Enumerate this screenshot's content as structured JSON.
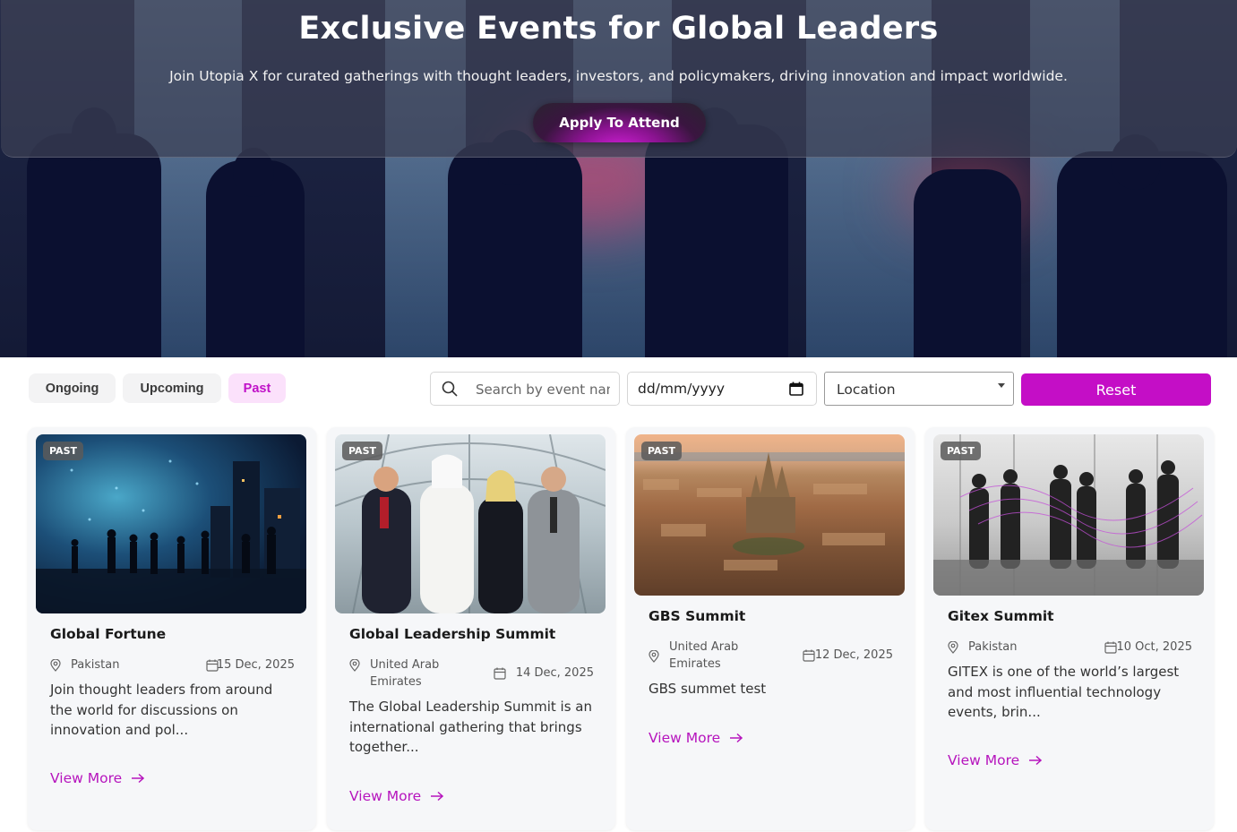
{
  "hero": {
    "title": "Exclusive Events for Global Leaders",
    "subtitle": "Join Utopia X for curated gatherings with thought leaders, investors, and policymakers, driving innovation and impact worldwide.",
    "cta_label": "Apply To Attend"
  },
  "filters": {
    "tabs": [
      {
        "label": "Ongoing",
        "active": false
      },
      {
        "label": "Upcoming",
        "active": false
      },
      {
        "label": "Past",
        "active": true
      }
    ],
    "search_placeholder": "Search by event name",
    "date_value": "dd/mm/yyyy",
    "location_value": "Location",
    "reset_label": "Reset"
  },
  "cards": [
    {
      "badge": "PAST",
      "title": "Global Fortune",
      "location": "Pakistan",
      "date": "15 Dec, 2025",
      "description": "Join thought leaders from around the world for discussions on innovation and pol...",
      "link": "View More"
    },
    {
      "badge": "PAST",
      "title": "Global Leadership Summit",
      "location": "United Arab Emirates",
      "date": "14 Dec, 2025",
      "description": "The Global Leadership Summit is an international gathering that brings together...",
      "link": "View More"
    },
    {
      "badge": "PAST",
      "title": "GBS Summit",
      "location": "United Arab Emirates",
      "date": "12 Dec, 2025",
      "description": "GBS summet test",
      "link": "View More"
    },
    {
      "badge": "PAST",
      "title": "Gitex Summit",
      "location": "Pakistan",
      "date": "10 Oct, 2025",
      "description": "GITEX is one of the world’s largest and most influential technology events, brin...",
      "link": "View More"
    }
  ],
  "colors": {
    "accent": "#c40ec6",
    "active_tab_bg": "#fbe1fb",
    "card_bg": "#f6f7f9"
  }
}
